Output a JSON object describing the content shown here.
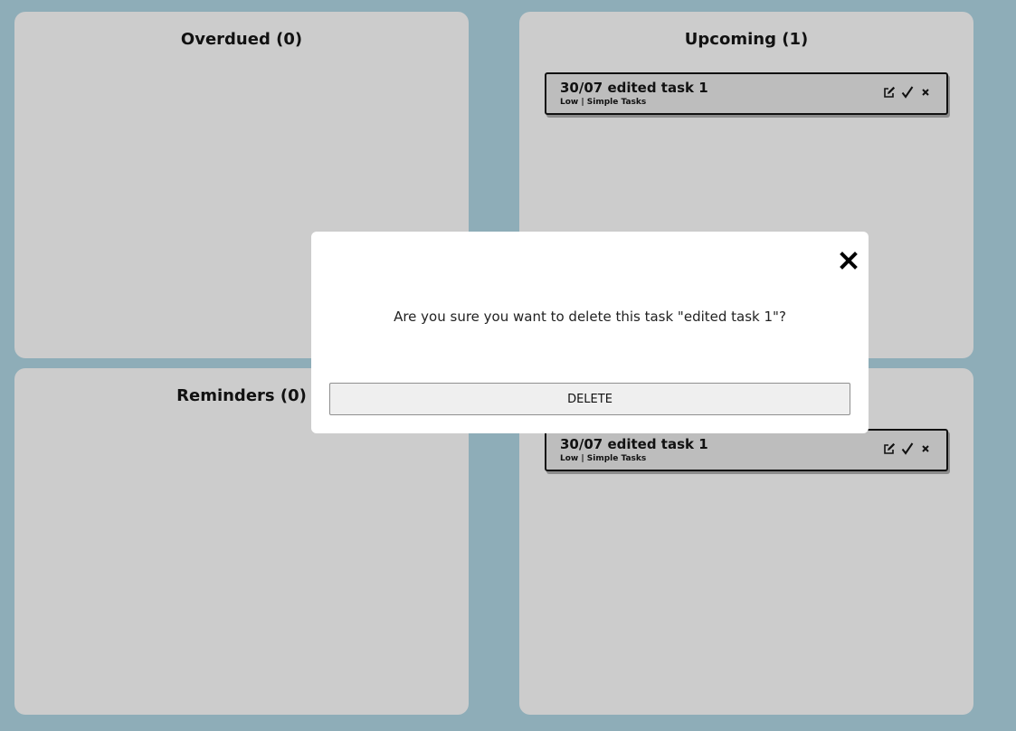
{
  "panels": {
    "overdue": {
      "title": "Overdued (0)"
    },
    "upcoming": {
      "title": "Upcoming (1)",
      "tasks": [
        {
          "title": "30/07 edited task 1",
          "meta": "Low | Simple Tasks"
        }
      ]
    },
    "reminders": {
      "title": "Reminders (0)"
    },
    "fourth": {
      "title": "",
      "tasks": [
        {
          "title": "30/07 edited task 1",
          "meta": "Low | Simple Tasks"
        }
      ]
    }
  },
  "task_actions": {
    "edit_icon": "edit-icon",
    "complete_icon": "checkmark-icon",
    "delete_icon": "close-icon"
  },
  "modal": {
    "message": "Are you sure you want to delete this task \"edited task 1\"?",
    "delete_label": "DELETE",
    "close_icon": "close-icon"
  },
  "colors": {
    "background": "#8eadb8",
    "panel": "#cccccc",
    "card": "#bdbdbd",
    "modal": "#ffffff"
  }
}
